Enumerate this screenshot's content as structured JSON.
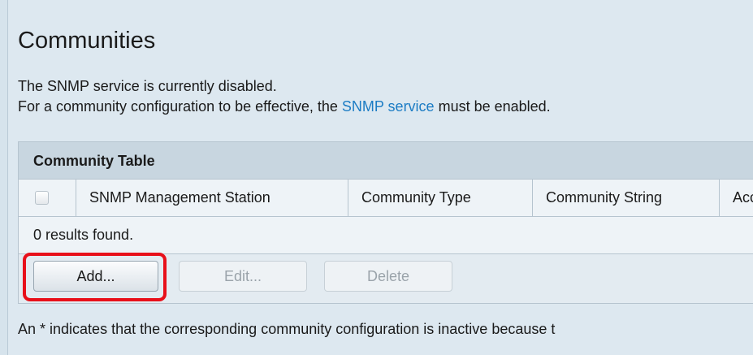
{
  "page": {
    "title": "Communities"
  },
  "messages": {
    "line1": "The SNMP service is currently disabled.",
    "line2_prefix": "For a community configuration to be effective, the ",
    "line2_link": "SNMP service",
    "line2_suffix": " must be enabled."
  },
  "table": {
    "title": "Community Table",
    "columns": [
      "SNMP Management Station",
      "Community Type",
      "Community String",
      "Acce"
    ],
    "status": "0 results found.",
    "rows": []
  },
  "buttons": {
    "add": "Add...",
    "edit": "Edit...",
    "delete": "Delete"
  },
  "footnote": "An * indicates that the corresponding community configuration is inactive because t",
  "colors": {
    "background": "#d6e3ec",
    "link": "#1c7cc4",
    "highlight": "#e8101a",
    "disabled_text": "#9aa3aa"
  }
}
